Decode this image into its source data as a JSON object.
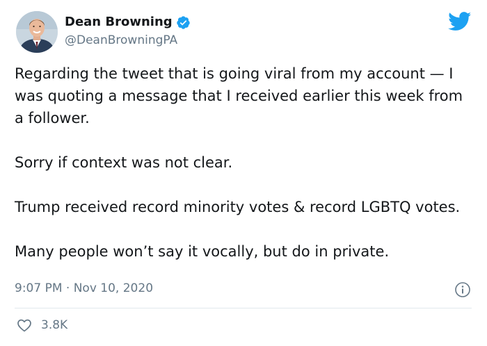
{
  "author": {
    "display_name": "Dean Browning",
    "handle": "@DeanBrowningPA",
    "verified": true,
    "avatar_icon": "profile-photo"
  },
  "platform": {
    "icon": "twitter-bird-icon",
    "brand_color": "#1da1f2"
  },
  "tweet": {
    "paragraphs": [
      "Regarding the tweet that is going viral from my account — I was quoting a message that I received earlier this week from a follower.",
      "Sorry if context was not clear.",
      "Trump received record minority votes & record LGBTQ votes.",
      "Many people won’t say it vocally, but do in private."
    ],
    "time": "9:07 PM",
    "separator": "·",
    "date": "Nov 10, 2020"
  },
  "engagement": {
    "likes": "3.8K"
  },
  "colors": {
    "text": "#14171a",
    "secondary": "#657786",
    "divider": "#e1e8ed",
    "accent": "#1da1f2"
  }
}
